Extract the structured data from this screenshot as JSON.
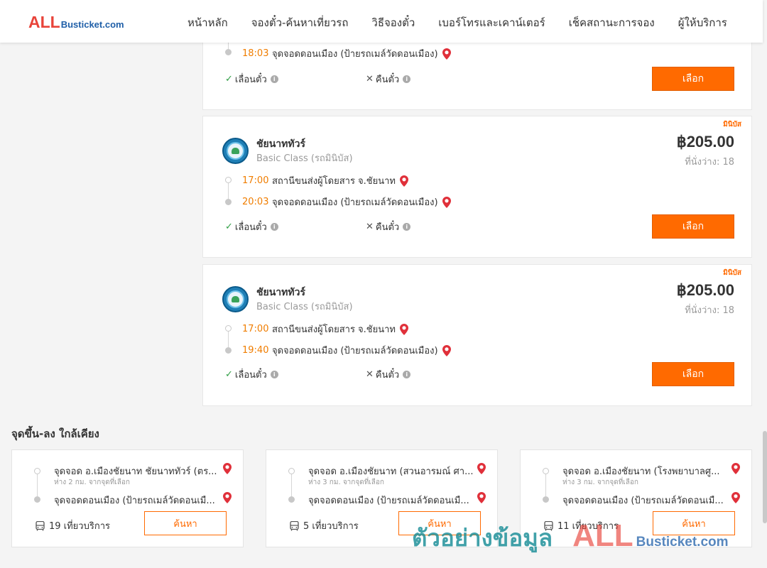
{
  "header": {
    "logo_all": "ALL",
    "logo_busticket": "Busticket.com",
    "nav": [
      "หน้าหลัก",
      "จองตั๋ว-ค้นหาเที่ยวรถ",
      "วิธีจองตั๋ว",
      "เบอร์โทรและเคาน์เตอร์",
      "เช็คสถานะการจอง",
      "ผู้ให้บริการ"
    ]
  },
  "trips": [
    {
      "arrive_time": "18:03",
      "arrive_stop": "จุดจอดดอนเมือง (ป้ายรถเมล์วัดดอนเมือง)",
      "reschedule_label": "เลื่อนตั๋ว",
      "refund_label": "คืนตั๋ว",
      "select_label": "เลือก"
    },
    {
      "bus_type": "มินิบัส",
      "operator": "ชัยนาททัวร์",
      "class": "Basic Class (รถมินิบัส)",
      "price": "฿205.00",
      "seats": "ที่นั่งว่าง: 18",
      "depart_time": "17:00",
      "depart_stop": "สถานีขนส่งผู้โดยสาร จ.ชัยนาท",
      "arrive_time": "20:03",
      "arrive_stop": "จุดจอดดอนเมือง (ป้ายรถเมล์วัดดอนเมือง)",
      "reschedule_label": "เลื่อนตั๋ว",
      "refund_label": "คืนตั๋ว",
      "select_label": "เลือก"
    },
    {
      "bus_type": "มินิบัส",
      "operator": "ชัยนาททัวร์",
      "class": "Basic Class (รถมินิบัส)",
      "price": "฿205.00",
      "seats": "ที่นั่งว่าง: 18",
      "depart_time": "17:00",
      "depart_stop": "สถานีขนส่งผู้โดยสาร จ.ชัยนาท",
      "arrive_time": "19:40",
      "arrive_stop": "จุดจอดดอนเมือง (ป้ายรถเมล์วัดดอนเมือง)",
      "reschedule_label": "เลื่อนตั๋ว",
      "refund_label": "คืนตั๋ว",
      "select_label": "เลือก"
    }
  ],
  "nearby": {
    "title": "จุดขึ้น-ลง ใกล้เคียง",
    "cards": [
      {
        "from": "จุดจอด อ.เมืองชัยนาท ชัยนาททัวร์ (ตร...",
        "distance": "ห่าง 2 กม. จากจุดที่เลือก",
        "to": "จุดจอดดอนเมือง (ป้ายรถเมล์วัดดอนเมื...",
        "trips": "19 เที่ยวบริการ",
        "search_label": "ค้นหา"
      },
      {
        "from": "จุดจอด อ.เมืองชัยนาท (สวนอารมณ์ ศา...",
        "distance": "ห่าง 3 กม. จากจุดที่เลือก",
        "to": "จุดจอดดอนเมือง (ป้ายรถเมล์วัดดอนเมื...",
        "trips": "5 เที่ยวบริการ",
        "search_label": "ค้นหา"
      },
      {
        "from": "จุดจอด อ.เมืองชัยนาท (โรงพยาบาลศู...",
        "distance": "ห่าง 3 กม. จากจุดที่เลือก",
        "to": "จุดจอดดอนเมือง (ป้ายรถเมล์วัดดอนเมื...",
        "trips": "11 เที่ยวบริการ",
        "search_label": "ค้นหา"
      }
    ]
  },
  "watermark": {
    "text": "ตัวอย่างข้อมูล",
    "all": "ALL",
    "busticket": "Busticket.com"
  },
  "icons": {
    "pin": "map-pin-icon",
    "check": "check-icon",
    "cross": "close-icon",
    "info": "info-icon",
    "bus": "bus-icon"
  },
  "colors": {
    "accent": "#ff6a00",
    "time": "#f07d00",
    "check": "#2f9e44",
    "pin": "#e0303a",
    "logo_red": "#e8443a",
    "logo_blue": "#1f5fa8"
  }
}
